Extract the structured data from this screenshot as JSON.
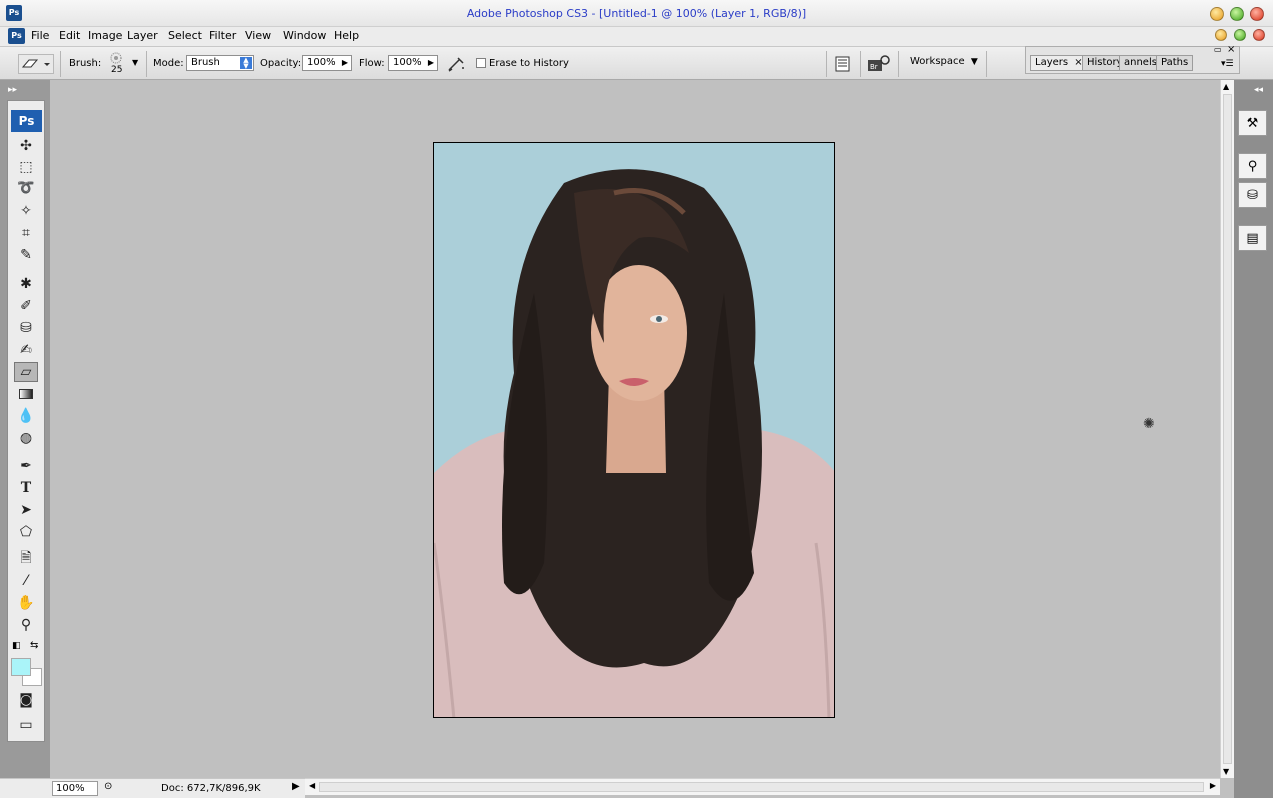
{
  "window": {
    "title": "Adobe Photoshop CS3 - [Untitled-1 @ 100% (Layer 1, RGB/8)]",
    "app_badge": "Ps"
  },
  "menu": [
    "File",
    "Edit",
    "Image",
    "Layer",
    "Select",
    "Filter",
    "View",
    "Window",
    "Help"
  ],
  "options": {
    "brush_label": "Brush:",
    "brush_size": "25",
    "mode_label": "Mode:",
    "mode_value": "Brush",
    "opacity_label": "Opacity:",
    "opacity_value": "100%",
    "flow_label": "Flow:",
    "flow_value": "100%",
    "erase_history_label": "Erase to History",
    "erase_history_checked": false,
    "workspace_label": "Workspace"
  },
  "panel_tabs": [
    "Layers",
    "History",
    "annels",
    "Paths"
  ],
  "toolbox": {
    "badge": "Ps",
    "foreground_color": "#aaf4f9",
    "background_color": "#ffffff",
    "active_tool": "eraser-tool"
  },
  "document": {
    "background_color": "#abcfd9"
  },
  "status": {
    "zoom": "100%",
    "doc_info": "Doc: 672,7K/896,9K"
  }
}
